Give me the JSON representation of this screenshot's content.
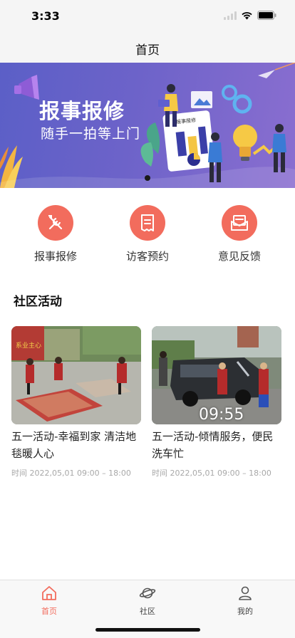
{
  "status_bar": {
    "time": "3:33"
  },
  "nav": {
    "title": "首页"
  },
  "banner": {
    "title": "报事报修",
    "subtitle": "随手一拍等上门",
    "doc_label": "报事报修"
  },
  "quick_menu": [
    {
      "label": "报事报修",
      "icon": "wrench-screwdriver-icon"
    },
    {
      "label": "访客预约",
      "icon": "receipt-icon"
    },
    {
      "label": "意见反馈",
      "icon": "mail-icon"
    }
  ],
  "community": {
    "title": "社区活动",
    "items": [
      {
        "title": "五一活动-幸福到家 清洁地毯暖人心",
        "time": "时间 2022,05,01 09:00 – 18:00",
        "sign": "系业主心"
      },
      {
        "title": "五一活动-倾情服务，便民洗车忙",
        "time": "时间 2022,05,01 09:00 – 18:00",
        "duration": "09:55"
      }
    ]
  },
  "tab_bar": {
    "tabs": [
      {
        "label": "首页",
        "icon": "home-icon",
        "active": true
      },
      {
        "label": "社区",
        "icon": "planet-icon",
        "active": false
      },
      {
        "label": "我的",
        "icon": "person-icon",
        "active": false
      }
    ]
  },
  "colors": {
    "accent": "#f26c5d",
    "banner": "#6d63c9"
  }
}
